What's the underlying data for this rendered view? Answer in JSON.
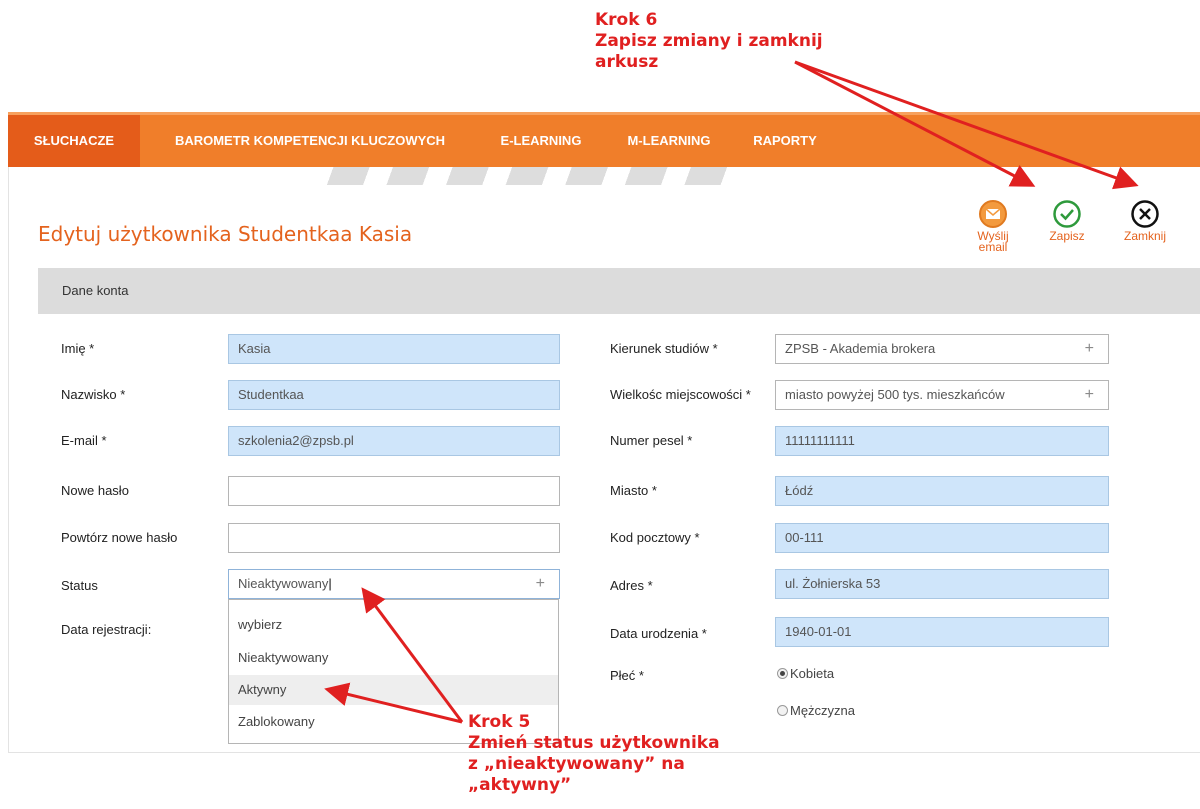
{
  "annotations": {
    "step6": [
      "Krok 6",
      "Zapisz zmiany i zamknij",
      "arkusz"
    ],
    "step5": [
      "Krok 5",
      "Zmień status użytkownika",
      "z „nieaktywowany” na",
      "„aktywny”"
    ]
  },
  "nav": {
    "items": [
      "SŁUCHACZE",
      "BAROMETR KOMPETENCJI KLUCZOWYCH",
      "E-LEARNING",
      "M-LEARNING",
      "RAPORTY"
    ],
    "active": "SŁUCHACZE"
  },
  "page": {
    "title": "Edytuj użytkownika Studentkaa Kasia"
  },
  "toolbar": {
    "send_email": [
      "Wyślij",
      "email"
    ],
    "save": "Zapisz",
    "close": "Zamknij"
  },
  "section": {
    "title": "Dane konta"
  },
  "left_form": {
    "first_name": {
      "label": "Imię *",
      "value": "Kasia"
    },
    "last_name": {
      "label": "Nazwisko *",
      "value": "Studentkaa"
    },
    "email": {
      "label": "E-mail *",
      "value": "szkolenia2@zpsb.pl"
    },
    "new_password": {
      "label": "Nowe hasło",
      "value": ""
    },
    "repeat_password": {
      "label": "Powtórz nowe hasło",
      "value": ""
    },
    "status": {
      "label": "Status",
      "value": "Nieaktywowany",
      "options": [
        "wybierz",
        "Nieaktywowany",
        "Aktywny",
        "Zablokowany"
      ],
      "highlighted": "Aktywny"
    },
    "registration_date": {
      "label": "Data rejestracji:"
    }
  },
  "right_form": {
    "study_program": {
      "label": "Kierunek studiów *",
      "value": "ZPSB - Akademia brokera"
    },
    "town_size": {
      "label": "Wielkośc miejscowości *",
      "value": "miasto powyżej 500 tys. mieszkańców"
    },
    "pesel": {
      "label": "Numer pesel *",
      "value": "11111111111"
    },
    "city": {
      "label": "Miasto *",
      "value": "Łódź"
    },
    "postal_code": {
      "label": "Kod pocztowy *",
      "value": "00-111"
    },
    "address": {
      "label": "Adres *",
      "value": "ul. Żołnierska 53"
    },
    "birth_date": {
      "label": "Data urodzenia *",
      "value": "1940-01-01"
    },
    "gender": {
      "label": "Płeć *",
      "options": [
        "Kobieta",
        "Mężczyzna"
      ],
      "selected": "Kobieta"
    }
  },
  "colors": {
    "accent": "#f07e2a",
    "annotation": "#e02020",
    "field_fill": "#cfe5fa",
    "title": "#e4631e",
    "save_green": "#2e9a3c"
  }
}
